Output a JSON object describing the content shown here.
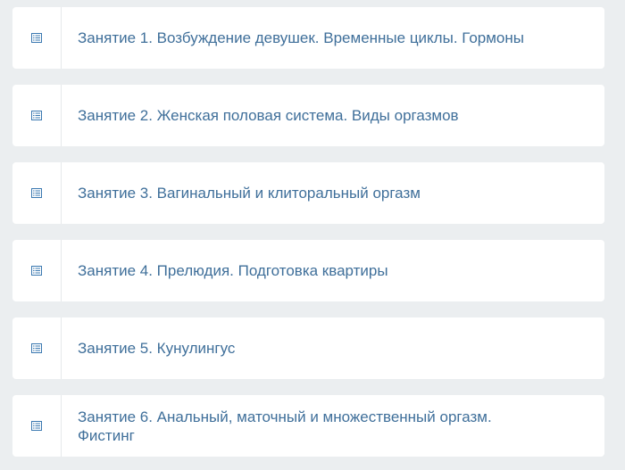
{
  "lessons": [
    {
      "title": "Занятие 1. Возбуждение девушек. Временные циклы. Гормоны",
      "icon": "document-list-icon"
    },
    {
      "title": "Занятие 2. Женская половая система. Виды оргазмов",
      "icon": "document-list-icon"
    },
    {
      "title": "Занятие 3. Вагинальный и клиторальный оргазм",
      "icon": "document-list-icon"
    },
    {
      "title": "Занятие 4. Прелюдия. Подготовка квартиры",
      "icon": "document-list-icon"
    },
    {
      "title": "Занятие 5. Кунулингус",
      "icon": "document-list-icon"
    },
    {
      "title": "Занятие 6. Анальный, маточный и множественный оргазм. Фистинг",
      "icon": "document-list-icon"
    }
  ],
  "colors": {
    "background": "#ebeef0",
    "card": "#ffffff",
    "title_text": "#3f6f9a",
    "icon": "#3a78b0"
  }
}
